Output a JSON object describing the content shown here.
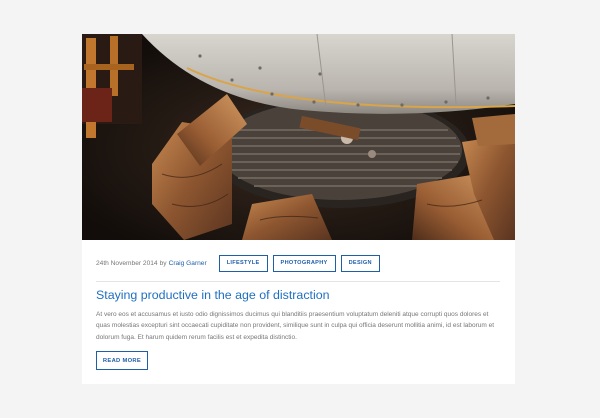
{
  "post": {
    "image_alt": "Firewood around a grill under a steel hood",
    "date": "24th November 2014",
    "by": "by",
    "author": "Craig Garner",
    "tags": [
      "LIFESTYLE",
      "PHOTOGRAPHY",
      "DESIGN"
    ],
    "title": "Staying productive in the age of distraction",
    "excerpt": "At vero eos et accusamus et iusto odio dignissimos ducimus qui blanditiis praesentium voluptatum deleniti atque corrupti quos dolores et quas molestias excepturi sint occaecati cupiditate non provident, similique sunt in culpa qui officia deserunt mollitia animi, id est laborum et dolorum fuga. Et harum quidem rerum facilis est et expedita distinctio.",
    "read_more": "READ MORE"
  },
  "colors": {
    "accent": "#1f5fa8",
    "title": "#1f6fc1",
    "page_bg": "#f4f4f4",
    "card_bg": "#ffffff",
    "text_muted": "#777777"
  }
}
